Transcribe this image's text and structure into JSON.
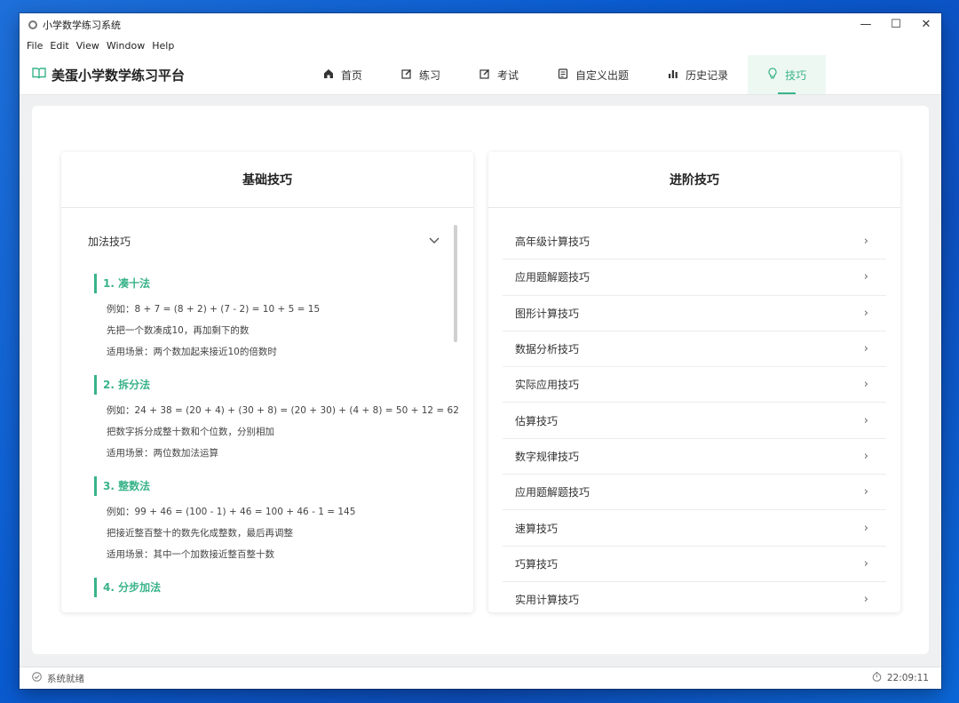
{
  "window": {
    "title": "小学数学练习系统",
    "minimize": "—",
    "maximize": "☐",
    "close": "✕"
  },
  "menu": [
    "File",
    "Edit",
    "View",
    "Window",
    "Help"
  ],
  "header": {
    "brand": "美蛋小学数学练习平台",
    "nav": [
      {
        "label": "首页",
        "icon": "home-icon"
      },
      {
        "label": "练习",
        "icon": "edit-icon"
      },
      {
        "label": "考试",
        "icon": "edit-icon"
      },
      {
        "label": "自定义出题",
        "icon": "document-icon"
      },
      {
        "label": "历史记录",
        "icon": "bar-chart-icon"
      },
      {
        "label": "技巧",
        "icon": "lightbulb-icon",
        "active": true
      }
    ]
  },
  "basic_panel": {
    "title": "基础技巧",
    "accordion_title": "加法技巧",
    "tips": [
      {
        "title": "1. 凑十法",
        "lines": [
          "例如：8 + 7 = (8 + 2) + (7 - 2) = 10 + 5 = 15",
          "先把一个数凑成10，再加剩下的数",
          "适用场景：两个数加起来接近10的倍数时"
        ]
      },
      {
        "title": "2. 拆分法",
        "lines": [
          "例如：24 + 38 = (20 + 4) + (30 + 8) = (20 + 30) + (4 + 8) = 50 + 12 = 62",
          "把数字拆分成整十数和个位数，分别相加",
          "适用场景：两位数加法运算"
        ]
      },
      {
        "title": "3. 整数法",
        "lines": [
          "例如：99 + 46 = (100 - 1) + 46 = 100 + 46 - 1 = 145",
          "把接近整百整十的数先化成整数，最后再调整",
          "适用场景：其中一个加数接近整百整十数"
        ]
      },
      {
        "title": "4. 分步加法",
        "lines": []
      }
    ]
  },
  "advanced_panel": {
    "title": "进阶技巧",
    "items": [
      "高年级计算技巧",
      "应用题解题技巧",
      "图形计算技巧",
      "数据分析技巧",
      "实际应用技巧",
      "估算技巧",
      "数字规律技巧",
      "应用题解题技巧",
      "速算技巧",
      "巧算技巧",
      "实用计算技巧"
    ]
  },
  "status": {
    "text": "系统就绪",
    "time": "22:09:11"
  },
  "colors": {
    "accent": "#39b38a",
    "desktop": "#0a5bd0"
  }
}
